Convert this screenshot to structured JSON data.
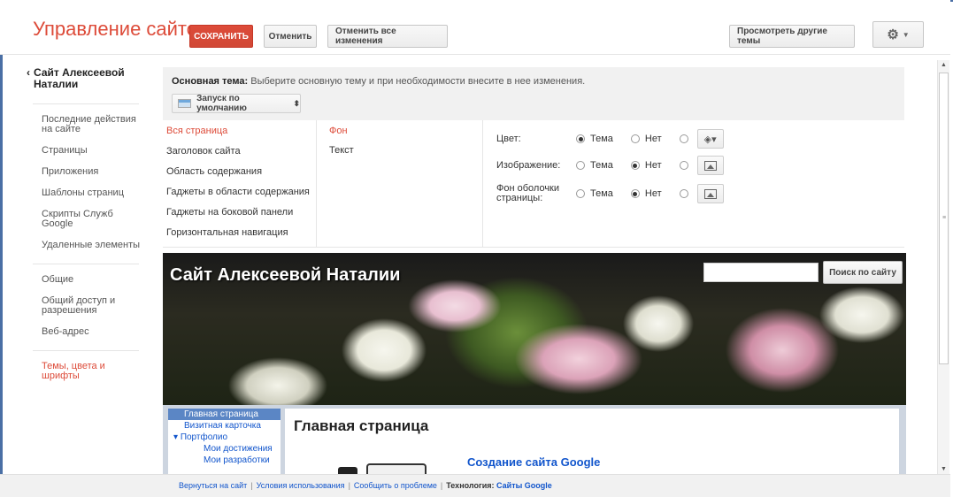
{
  "header": {
    "app_title": "Управление сайтом",
    "save": "СОХРАНИТЬ",
    "cancel": "Отменить",
    "cancel_all": "Отменить все изменения",
    "view_themes": "Просмотреть другие темы",
    "settings_icon": "gear-icon"
  },
  "sidebar": {
    "back_label": "Сайт Алексеевой Наталии",
    "items": [
      {
        "label": "Последние действия на сайте"
      },
      {
        "label": "Страницы"
      },
      {
        "label": "Приложения"
      },
      {
        "label": "Шаблоны страниц"
      },
      {
        "label": "Скрипты Служб Google"
      },
      {
        "label": "Удаленные элементы"
      },
      {
        "label": "Общие"
      },
      {
        "label": "Общий доступ и разрешения"
      },
      {
        "label": "Веб-адрес"
      },
      {
        "label": "Темы, цвета и шрифты"
      }
    ]
  },
  "theme": {
    "label": "Основная тема:",
    "description": "Выберите основную тему и при необходимости внесите в нее изменения.",
    "selected": "Запуск по умолчанию"
  },
  "sections": [
    "Вся страница",
    "Заголовок сайта",
    "Область содержания",
    "Гаджеты в области содержания",
    "Гаджеты на боковой панели",
    "Горизонтальная навигация"
  ],
  "subsections": [
    "Фон",
    "Текст"
  ],
  "options": {
    "color_label": "Цвет:",
    "image_label": "Изображение:",
    "wrapper_label": "Фон оболочки страницы:",
    "theme_opt": "Тема",
    "none_opt": "Нет"
  },
  "preview": {
    "site_title": "Сайт Алексеевой Наталии",
    "search_button": "Поиск по сайту",
    "nav": [
      "Главная страница",
      "Визитная карточка",
      "Портфолио",
      "Мои достижения",
      "Мои разработки"
    ],
    "page_heading": "Главная страница",
    "content_link": "Создание сайта Google"
  },
  "footer": {
    "back": "Вернуться на сайт",
    "terms": "Условия использования",
    "report": "Сообщить о проблеме",
    "tech_label": "Технология:",
    "tech_link": "Сайты Google"
  },
  "colors": {
    "accent": "#dd4b39",
    "link": "#1155cc"
  }
}
